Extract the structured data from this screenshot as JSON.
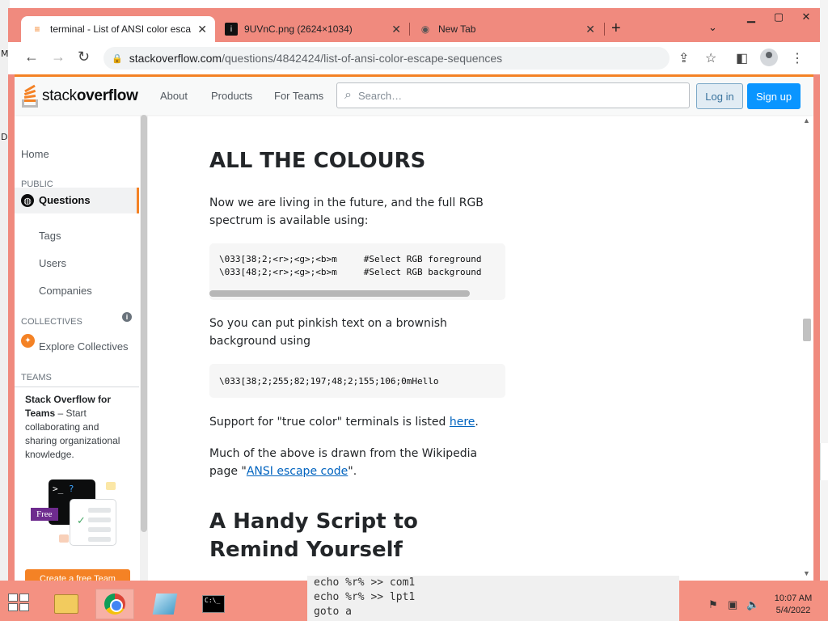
{
  "desktop": {
    "left_chars": [
      "M",
      "D"
    ]
  },
  "browser": {
    "tabs": [
      {
        "title": "terminal - List of ANSI color esca",
        "favicon": "stackoverflow-icon",
        "active": true
      },
      {
        "title": "9UVnC.png (2624×1034)",
        "favicon": "image-icon",
        "active": false
      },
      {
        "title": "New Tab",
        "favicon": "chrome-icon",
        "active": false
      }
    ],
    "url_host": "stackoverflow.com",
    "url_path": "/questions/4842424/list-of-ansi-color-escape-sequences"
  },
  "so_header": {
    "logo_prefix": "stack",
    "logo_bold": "overflow",
    "nav": [
      "About",
      "Products",
      "For Teams"
    ],
    "search_placeholder": "Search…",
    "login": "Log in",
    "signup": "Sign up"
  },
  "sidebar": {
    "home": "Home",
    "public_heading": "PUBLIC",
    "questions": "Questions",
    "tags": "Tags",
    "users": "Users",
    "companies": "Companies",
    "collectives_heading": "COLLECTIVES",
    "explore_collectives": "Explore Collectives",
    "teams_heading": "TEAMS",
    "teams_title": "Stack Overflow for Teams",
    "teams_dash": " – ",
    "teams_body": "Start collaborating and sharing organizational knowledge.",
    "promo_prompt": ">_",
    "promo_q": "?",
    "promo_free": "Free",
    "create_team": "Create a free Team"
  },
  "content": {
    "heading": "ALL THE COLOURS",
    "p1": "Now we are living in the future, and the full RGB spectrum is available using:",
    "code1": "\\033[38;2;<r>;<g>;<b>m     #Select RGB foreground\n\\033[48;2;<r>;<g>;<b>m     #Select RGB background",
    "p2": "So you can put pinkish text on a brownish background using",
    "code2": "\\033[38;2;255;82;197;48;2;155;106;0mHello",
    "p3_before": "Support for \"true color\" terminals is listed ",
    "p3_link": "here",
    "p3_after": ".",
    "p4_before": "Much of the above is drawn from the Wikipedia page \"",
    "p4_link": "ANSI escape code",
    "p4_after": "\".",
    "heading2": "A Handy Script to Remind Yourself"
  },
  "console": {
    "lines": [
      "echo %r% >> com1",
      "echo %r% >> lpt1",
      "goto a"
    ]
  },
  "taskbar": {
    "time": "10:07 AM",
    "date": "5/4/2022",
    "cmd_label": "C:\\_"
  }
}
